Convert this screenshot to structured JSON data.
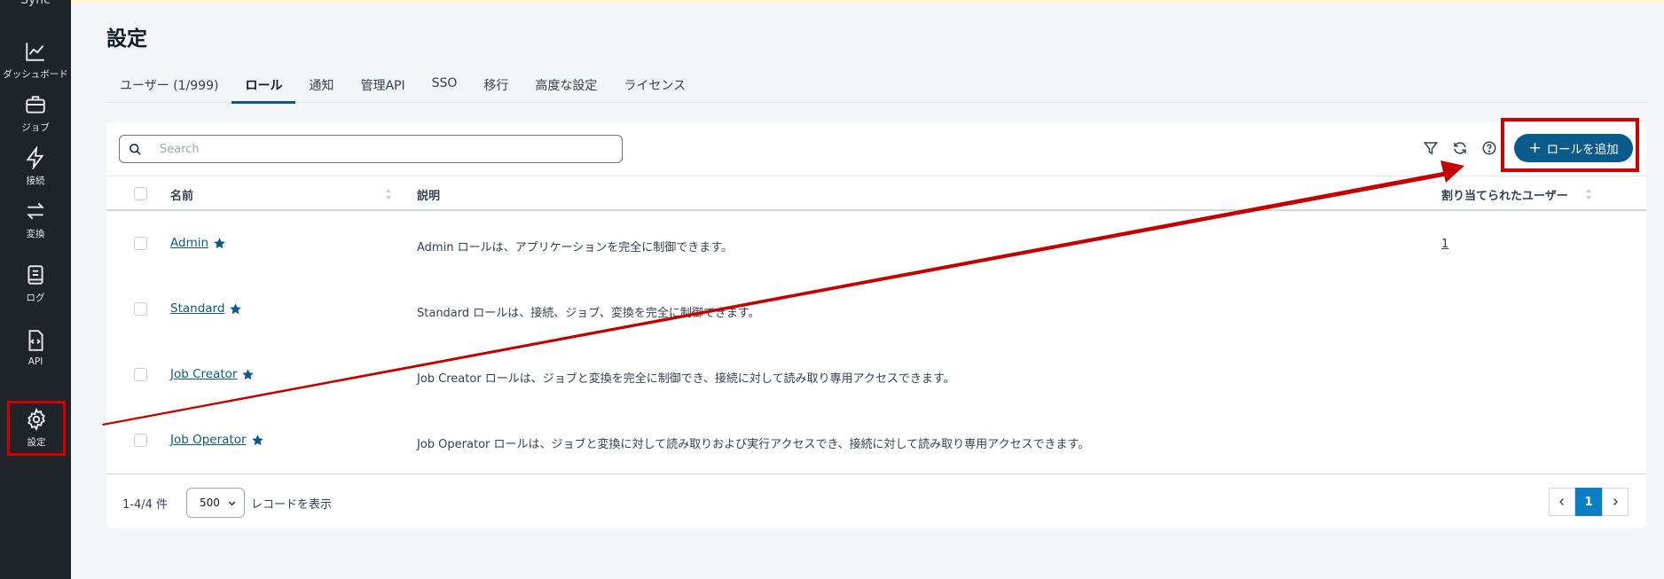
{
  "app": {
    "brand": "Sync"
  },
  "sidebar": {
    "items": [
      {
        "label": "ダッシュボード",
        "icon": "chart-line-icon"
      },
      {
        "label": "ジョブ",
        "icon": "briefcase-icon"
      },
      {
        "label": "接続",
        "icon": "lightning-icon"
      },
      {
        "label": "変換",
        "icon": "swap-arrows-icon"
      },
      {
        "label": "ログ",
        "icon": "log-book-icon"
      },
      {
        "label": "API",
        "icon": "code-file-icon"
      },
      {
        "label": "設定",
        "icon": "gear-icon",
        "active": true
      }
    ]
  },
  "page": {
    "title": "設定"
  },
  "tabs": [
    {
      "label": "ユーザー (1/999)"
    },
    {
      "label": "ロール",
      "active": true
    },
    {
      "label": "通知"
    },
    {
      "label": "管理API"
    },
    {
      "label": "SSO"
    },
    {
      "label": "移行"
    },
    {
      "label": "高度な設定"
    },
    {
      "label": "ライセンス"
    }
  ],
  "toolbar": {
    "search_placeholder": "Search",
    "add_role_label": "ロールを追加"
  },
  "table": {
    "headers": {
      "name": "名前",
      "description": "説明",
      "assigned_users": "割り当てられたユーザー"
    },
    "rows": [
      {
        "name": "Admin",
        "description": "Admin ロールは、アプリケーションを完全に制御できます。",
        "assigned_users": "1"
      },
      {
        "name": "Standard",
        "description": "Standard ロールは、接続、ジョブ、変換を完全に制御できます。",
        "assigned_users": ""
      },
      {
        "name": "Job Creator",
        "description": "Job Creator ロールは、ジョブと変換を完全に制御でき、接続に対して読み取り専用アクセスできます。",
        "assigned_users": ""
      },
      {
        "name": "Job Operator",
        "description": "Job Operator ロールは、ジョブと変換に対して読み取りおよび実行アクセスでき、接続に対して読み取り専用アクセスできます。",
        "assigned_users": ""
      }
    ]
  },
  "footer": {
    "range_text": "1-4/4 件",
    "page_size": "500",
    "records_label": "レコードを表示",
    "current_page": "1"
  },
  "colors": {
    "accent": "#0b5a8c",
    "annotation_red": "#d10000",
    "sidebar_bg": "#1f2429",
    "pager_active": "#0a7ec2"
  }
}
